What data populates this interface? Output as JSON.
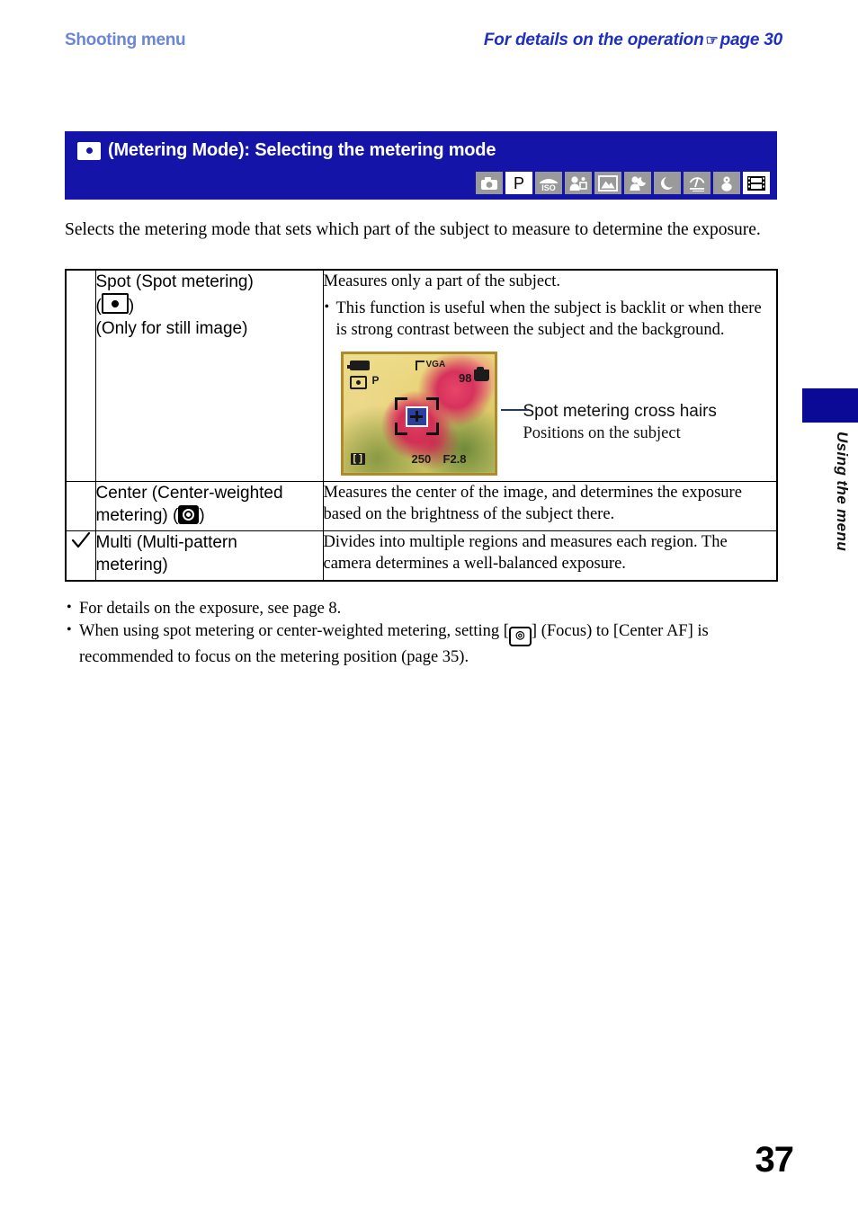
{
  "running_head": {
    "left": "Shooting menu",
    "right": "For details on the operation",
    "pointer_icon": "pointing-hand-icon",
    "right_suffix": "page 30",
    "left_color": "#6b86d4",
    "right_color": "#1f2fbe"
  },
  "banner": {
    "icon": "spot-metering-icon",
    "title": "(Metering Mode): Selecting the metering mode",
    "background_color": "#1414a8",
    "mode_icons": [
      {
        "name": "auto-camera-mode-icon",
        "label": "",
        "active": false
      },
      {
        "name": "program-mode-icon",
        "label": "P",
        "active": true
      },
      {
        "name": "high-sensitivity-mode-icon",
        "label": "ISO",
        "active": false
      },
      {
        "name": "soft-snap-mode-icon",
        "label": "",
        "active": false
      },
      {
        "name": "landscape-mode-icon",
        "label": "",
        "active": false
      },
      {
        "name": "twilight-portrait-mode-icon",
        "label": "",
        "active": false
      },
      {
        "name": "twilight-mode-icon",
        "label": "",
        "active": false
      },
      {
        "name": "beach-mode-icon",
        "label": "",
        "active": false
      },
      {
        "name": "snow-mode-icon",
        "label": "",
        "active": false
      },
      {
        "name": "movie-mode-icon",
        "label": "",
        "active": true
      }
    ]
  },
  "intro": "Selects the metering mode that sets which part of the subject to measure to determine the exposure.",
  "table": {
    "rows": [
      {
        "checked": false,
        "label_line1": "Spot (Spot metering)",
        "label_icon": "spot-metering-icon",
        "label_line3": "(Only for still image)",
        "desc_lead": "Measures only a part of the subject.",
        "desc_bullets": [
          "This function is useful when the subject is backlit or when there is strong contrast between the subject and the background."
        ],
        "has_figure": true
      },
      {
        "checked": false,
        "label_line1": "Center (Center-weighted",
        "label_line2": "metering) (",
        "label_icon": "center-weighted-metering-icon",
        "label_line2_end": ")",
        "desc_lead": "Measures the center of the image, and determines the exposure based on the brightness of the subject there.",
        "desc_bullets": [],
        "has_figure": false
      },
      {
        "checked": true,
        "label_line1": "Multi (Multi-pattern",
        "label_line2": "metering)",
        "desc_lead": "Divides into multiple regions and measures each region. The camera determines a well-balanced exposure.",
        "desc_bullets": [],
        "has_figure": false
      }
    ]
  },
  "figure": {
    "lcd": {
      "mode_letter": "P",
      "image_size": "VGA",
      "shots_remaining": "98",
      "shutter_speed": "250",
      "aperture": "F2.8",
      "bracket_indicator": "[ ]",
      "battery_icon": "battery-icon",
      "spot_icon": "spot-metering-icon",
      "card_icon": "memory-card-icon"
    },
    "callout_title": "Spot metering cross hairs",
    "callout_sub": "Positions on the subject"
  },
  "notes": [
    "For details on the exposure, see page 8.",
    "When using spot metering or center-weighted metering, setting [",
    "] (Focus) to [Center AF] is recommended to focus on the metering position (page 35)."
  ],
  "notes_focus_icon": "focus-icon",
  "side_tab": {
    "label": "Using the menu",
    "color": "#0a0a96"
  },
  "folio": "37"
}
